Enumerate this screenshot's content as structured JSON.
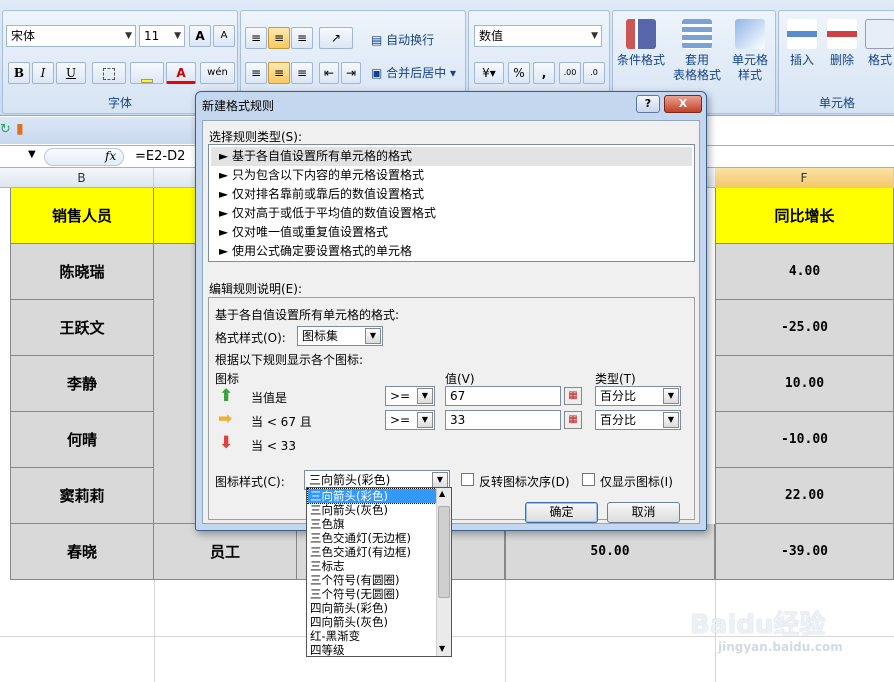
{
  "ribbon": {
    "font_name": "宋体",
    "font_size": "11",
    "grow_label": "A",
    "shrink_label": "A",
    "bold": "B",
    "italic": "I",
    "underline": "U",
    "font_color_label": "A",
    "phonetic_label": "wén",
    "wrap_text": "自动换行",
    "merge_center": "合并后居中",
    "number_format": "数值",
    "percent": "%",
    "comma": ",",
    "cond_format": "条件格式",
    "table_format_1": "套用",
    "table_format_2": "表格格式",
    "cell_style_1": "单元格",
    "cell_style_2": "样式",
    "insert": "插入",
    "delete": "删除",
    "format": "格式",
    "group_font": "字体",
    "group_cells": "单元格"
  },
  "formula_bar": {
    "fx": "fx",
    "formula": "=E2-D2"
  },
  "sheet": {
    "col_b": "B",
    "col_f": "F",
    "header_b": "销售人员",
    "header_f": "同比增长",
    "rows": [
      {
        "name": "陈晓瑞",
        "growth": "4.00"
      },
      {
        "name": "王跃文",
        "growth": "-25.00"
      },
      {
        "name": "李静",
        "growth": "10.00"
      },
      {
        "name": "何晴",
        "growth": "-10.00"
      },
      {
        "name": "窦莉莉",
        "growth": "22.00"
      },
      {
        "name": "春晓",
        "role": "员工",
        "e_value": "50.00",
        "growth": "-39.00"
      }
    ]
  },
  "dialog": {
    "title": "新建格式规则",
    "help": "?",
    "close": "X",
    "select_rule_type": "选择规则类型(S):",
    "rule_types": [
      "► 基于各自值设置所有单元格的格式",
      "► 只为包含以下内容的单元格设置格式",
      "► 仅对排名靠前或靠后的数值设置格式",
      "► 仅对高于或低于平均值的数值设置格式",
      "► 仅对唯一值或重复值设置格式",
      "► 使用公式确定要设置格式的单元格"
    ],
    "edit_rule_desc": "编辑规则说明(E):",
    "desc_line": "基于各自值设置所有单元格的格式:",
    "format_style_label": "格式样式(O):",
    "format_style_value": "图标集",
    "show_icons_by_rule": "根据以下规则显示各个图标:",
    "icon_col": "图标",
    "value_col": "值(V)",
    "type_col": "类型(T)",
    "rule1_text": "当值是",
    "rule1_op": ">=",
    "rule1_value": "67",
    "rule1_type": "百分比",
    "rule2_text": "当 < 67 且",
    "rule2_op": ">=",
    "rule2_value": "33",
    "rule2_type": "百分比",
    "rule3_text": "当 < 33",
    "icon_style_label": "图标样式(C):",
    "icon_style_value": "三向箭头(彩色)",
    "reverse_order": "反转图标次序(D)",
    "show_icon_only": "仅显示图标(I)",
    "ok": "确定",
    "cancel": "取消"
  },
  "icon_style_options": [
    "三向箭头(彩色)",
    "三向箭头(灰色)",
    "三色旗",
    "三色交通灯(无边框)",
    "三色交通灯(有边框)",
    "三标志",
    "三个符号(有圆圈)",
    "三个符号(无圆圈)",
    "四向箭头(彩色)",
    "四向箭头(灰色)",
    "红-黑渐变",
    "四等级"
  ],
  "watermark": {
    "logo": "Baidu经验",
    "url": "jingyan.baidu.com"
  },
  "colors": {
    "header_yellow": "#ffff00",
    "row_grey": "#d9d9d9",
    "arrow_up": "#3aa33a",
    "arrow_side": "#f0b030",
    "arrow_down": "#e04040",
    "selection": "#3399ff"
  }
}
